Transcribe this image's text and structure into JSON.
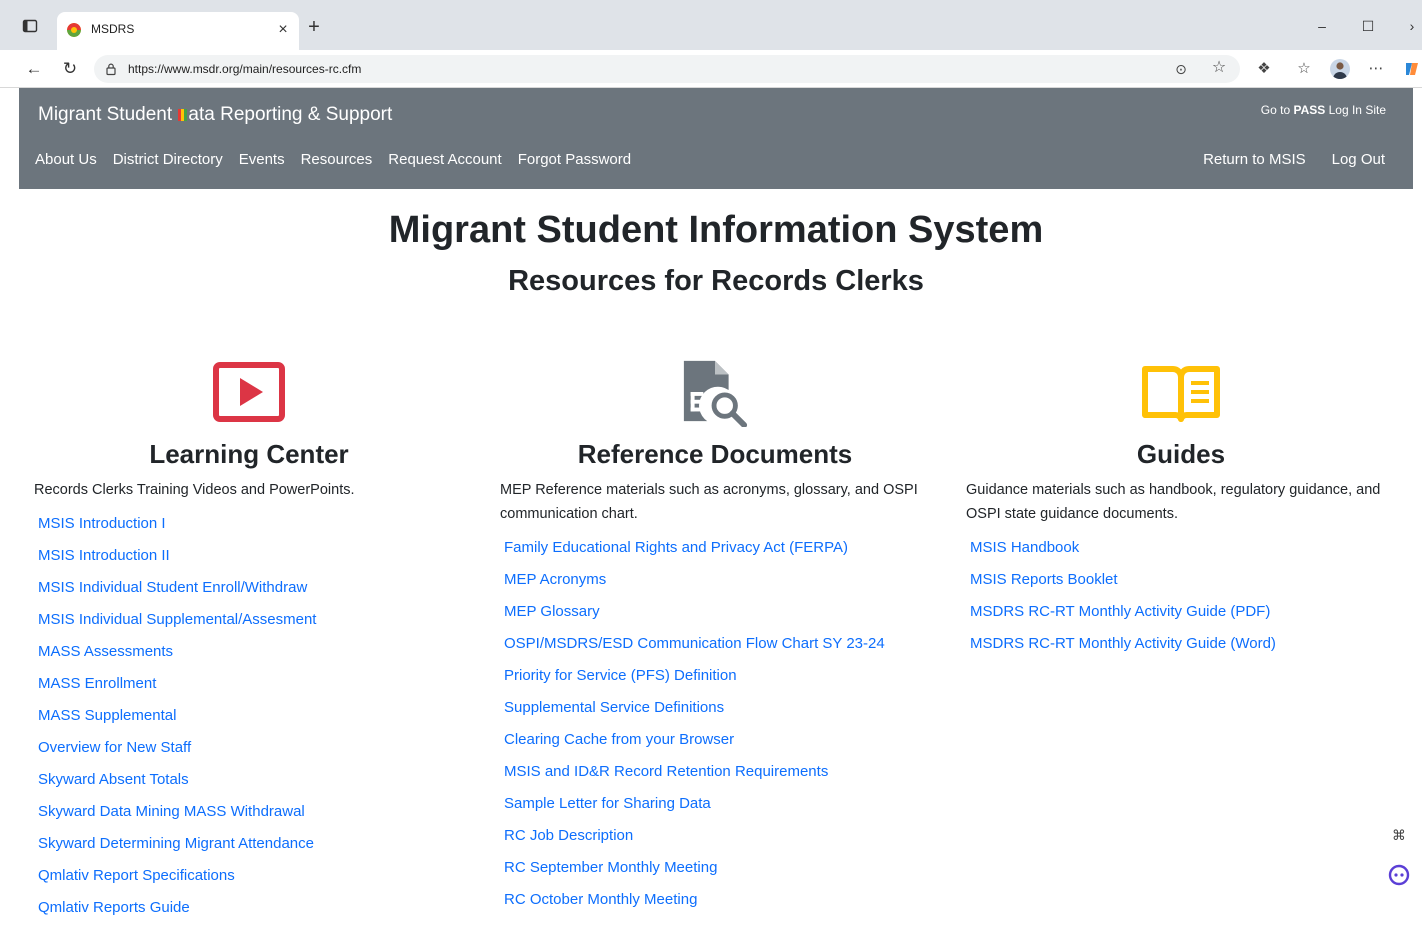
{
  "browser": {
    "tab_title": "MSDRS",
    "url": "https://www.msdr.org/main/resources-rc.cfm",
    "icons": {
      "tab_actions": "tab-actions-icon",
      "close": "close-icon",
      "new_tab": "plus-icon",
      "back": "back-arrow-icon",
      "refresh": "refresh-icon",
      "lock": "lock-icon",
      "reader": "reader-mode-icon",
      "favorite": "star-icon",
      "extensions": "extensions-icon",
      "favorites": "favorites-icon",
      "profile": "profile-avatar-icon",
      "more": "more-icon",
      "copilot": "copilot-icon"
    }
  },
  "header": {
    "brand_prefix": "Migrant Student ",
    "brand_suffix": "ata Reporting & Support",
    "pass_prefix": "Go to ",
    "pass_bold": "PASS",
    "pass_suffix": " Log In Site",
    "nav_left": [
      "About Us",
      "District Directory",
      "Events",
      "Resources",
      "Request Account",
      "Forgot Password"
    ],
    "nav_right": [
      "Return to MSIS",
      "Log Out"
    ]
  },
  "page": {
    "title": "Migrant Student Information System",
    "subtitle": "Resources for Records Clerks"
  },
  "columns": [
    {
      "icon": "video-play-icon",
      "heading": "Learning Center",
      "description": "Records Clerks Training Videos and PowerPoints.",
      "links": [
        "MSIS Introduction I",
        "MSIS Introduction II",
        "MSIS Individual Student Enroll/Withdraw",
        "MSIS Individual Supplemental/Assesment",
        "MASS Assessments",
        "MASS Enrollment",
        "MASS Supplemental",
        "Overview for New Staff",
        "Skyward Absent Totals",
        "Skyward Data Mining MASS Withdrawal",
        "Skyward Determining Migrant Attendance",
        "Qmlativ Report Specifications",
        "Qmlativ Reports Guide"
      ]
    },
    {
      "icon": "document-search-icon",
      "heading": "Reference Documents",
      "description": "MEP Reference materials such as acronyms, glossary, and OSPI communication chart.",
      "links": [
        "Family Educational Rights and Privacy Act (FERPA)",
        "MEP Acronyms",
        "MEP Glossary",
        "OSPI/MSDRS/ESD Communication Flow Chart SY 23-24",
        "Priority for Service (PFS) Definition",
        "Supplemental Service Definitions",
        "Clearing Cache from your Browser",
        "MSIS and ID&R Record Retention Requirements",
        "Sample Letter for Sharing Data",
        "RC Job Description",
        "RC September Monthly Meeting",
        "RC October Monthly Meeting"
      ]
    },
    {
      "icon": "open-book-icon",
      "heading": "Guides",
      "description": "Guidance materials such as handbook, regulatory guidance, and OSPI state guidance documents.",
      "links": [
        "MSIS Handbook",
        "MSIS Reports Booklet",
        "MSDRS RC-RT Monthly Activity Guide (PDF)",
        "MSDRS RC-RT Monthly Activity Guide (Word)"
      ]
    }
  ],
  "colors": {
    "header_bg": "#6c757d",
    "link": "#0d6efd",
    "video_icon": "#dc3545",
    "doc_icon": "#6c757d",
    "book_icon": "#ffc107"
  }
}
